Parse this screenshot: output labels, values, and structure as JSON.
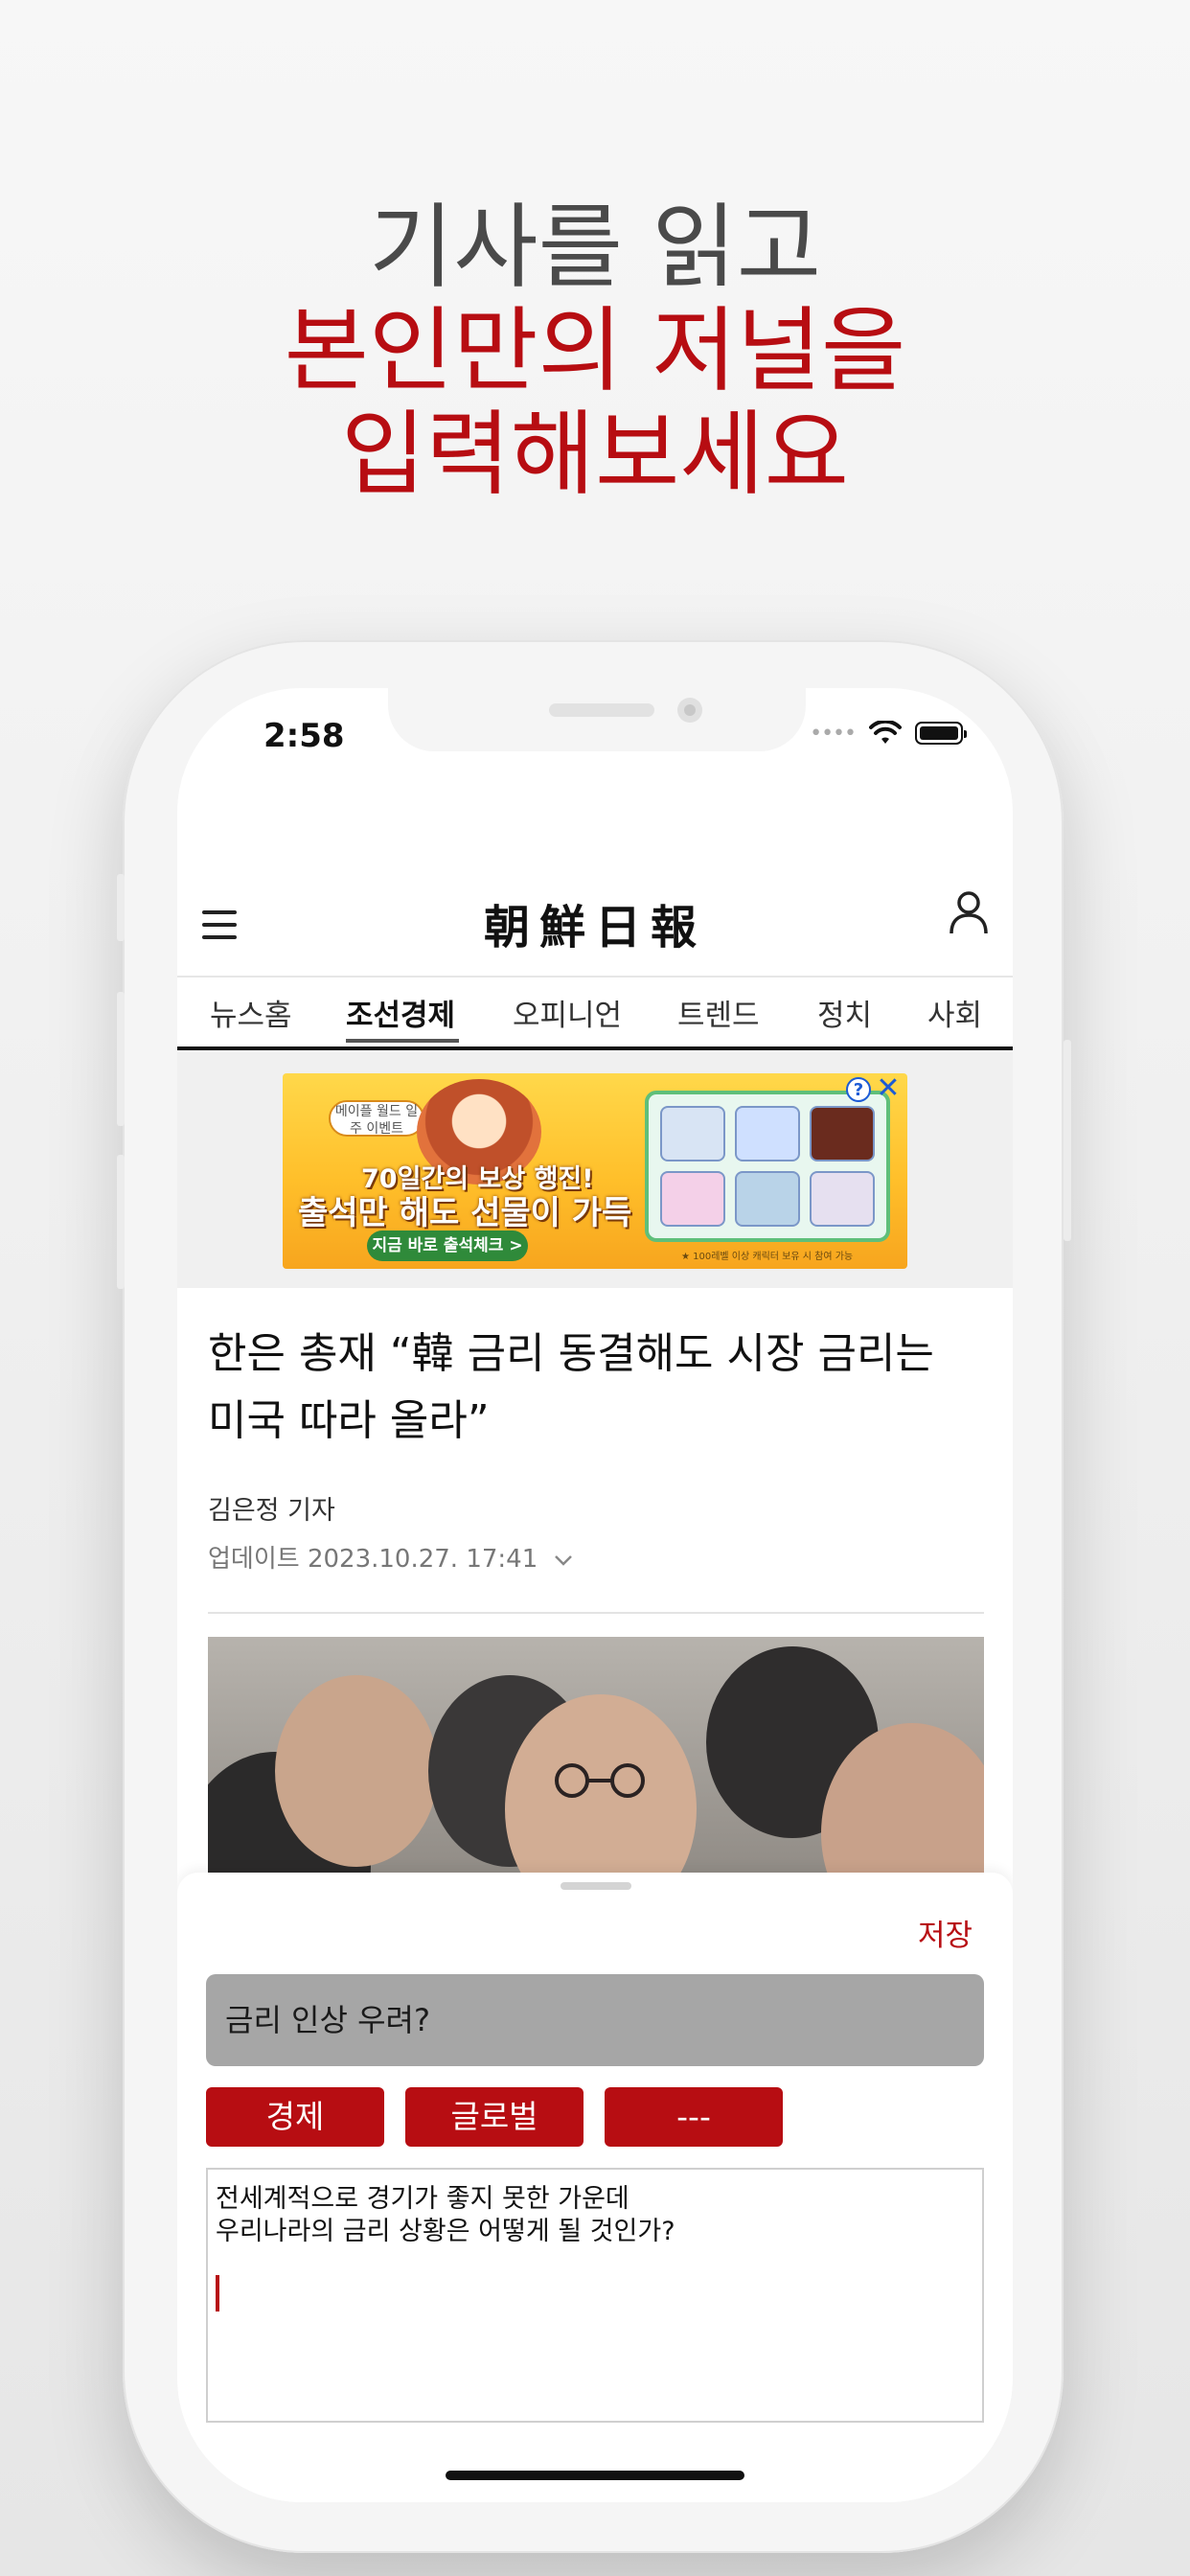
{
  "promo": {
    "line1": "기사를 읽고",
    "line2": "본인만의 저널을",
    "line3": "입력해보세요",
    "colors": {
      "primary": "#4a4a4a",
      "accent": "#b70d12"
    }
  },
  "status_bar": {
    "time": "2:58",
    "icons": [
      "cellular-dots-icon",
      "wifi-icon",
      "battery-icon"
    ]
  },
  "header": {
    "logo": "朝鮮日報",
    "icons": [
      "menu-icon",
      "user-icon"
    ]
  },
  "tabs": [
    {
      "label": "뉴스홈"
    },
    {
      "label": "조선경제",
      "active": true
    },
    {
      "label": "오피니언"
    },
    {
      "label": "트렌드"
    },
    {
      "label": "정치"
    },
    {
      "label": "사회"
    }
  ],
  "ad": {
    "badge": "메이플 월드 일주 이벤트",
    "line1": "70일간의 보상 행진!",
    "line2": "출석만 해도 선물이 가득",
    "cta": "지금 바로 출석체크 >",
    "fine_print": "★ 100레벨 이상 캐릭터 보유 시 참여 가능",
    "help": "?",
    "close": "✕"
  },
  "article": {
    "headline": "한은 총재 “韓 금리 동결해도 시장 금리는 미국 따라 올라”",
    "byline": "김은정 기자",
    "updated": "업데이트 2023.10.27. 17:41"
  },
  "journal": {
    "save_label": "저장",
    "title_value": "금리 인상 우려?",
    "tags": [
      "경제",
      "글로벌",
      "---"
    ],
    "body_line1": "전세계적으로 경기가 좋지 못한 가운데",
    "body_line2": "우리나라의 금리 상황은 어떻게 될 것인가?"
  }
}
